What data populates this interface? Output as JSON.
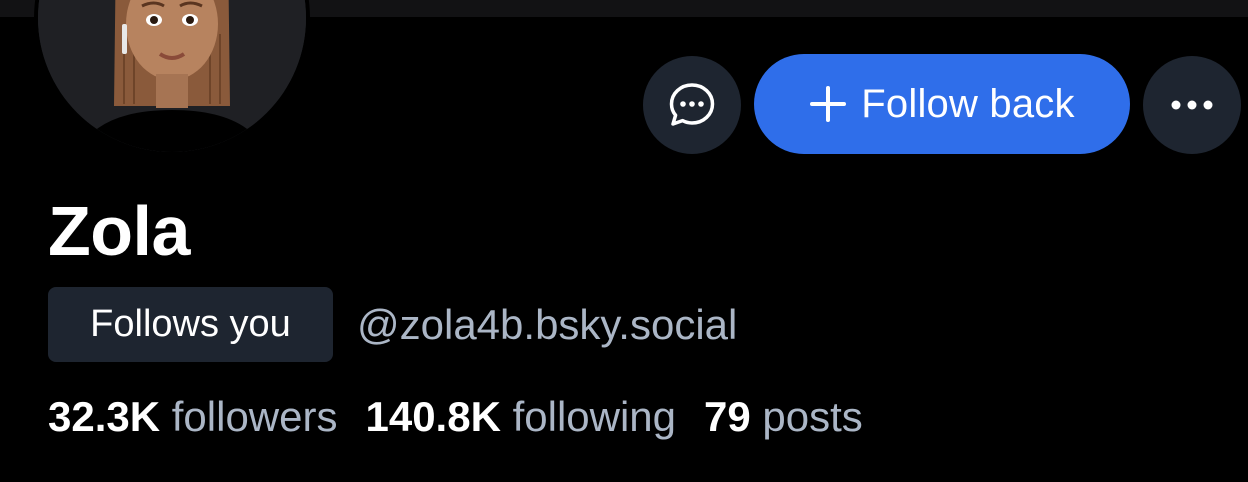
{
  "profile": {
    "display_name": "Zola",
    "handle": "@zola4b.bsky.social",
    "follows_you_badge": "Follows you",
    "avatar_icon": "memoji-avatar"
  },
  "actions": {
    "message_icon": "chat-bubble-icon",
    "follow_plus": "+",
    "follow_label": "Follow back",
    "more_icon": "ellipsis-icon"
  },
  "stats": [
    {
      "value": "32.3K",
      "label": "followers"
    },
    {
      "value": "140.8K",
      "label": "following"
    },
    {
      "value": "79",
      "label": "posts"
    }
  ],
  "colors": {
    "background": "#000000",
    "accent_button": "#2f6eea",
    "secondary_button": "#1e2530",
    "muted_text": "#abb6c6"
  }
}
